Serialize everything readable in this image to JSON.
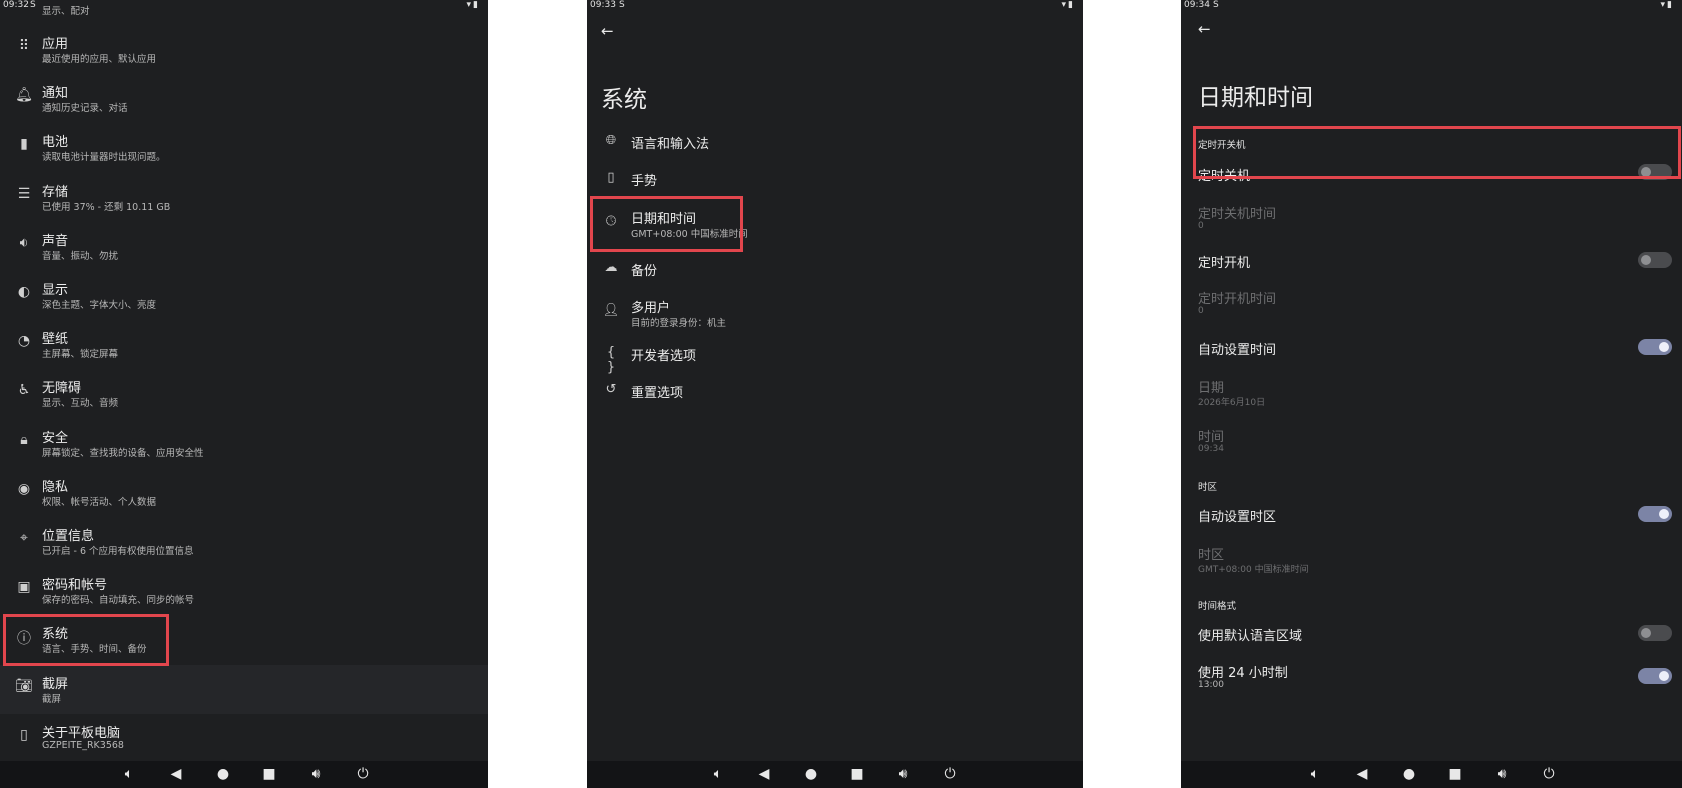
{
  "panel1": {
    "status_time": "09:32",
    "status_sim": "S",
    "status_icons": "▾▮",
    "partial_top_text": "显示、配对",
    "items": [
      {
        "icon": "apps-grid-icon",
        "glyph": "⠿",
        "title": "应用",
        "subtitle": "最近使用的应用、默认应用"
      },
      {
        "icon": "bell-icon",
        "glyph": "🔔︎",
        "title": "通知",
        "subtitle": "通知历史记录、对话"
      },
      {
        "icon": "battery-icon",
        "glyph": "▮",
        "title": "电池",
        "subtitle": "读取电池计量器时出现问题。"
      },
      {
        "icon": "storage-icon",
        "glyph": "☰",
        "title": "存储",
        "subtitle": "已使用 37% - 还剩 10.11 GB"
      },
      {
        "icon": "volume-icon",
        "glyph": "🔉︎",
        "title": "声音",
        "subtitle": "音量、振动、勿扰"
      },
      {
        "icon": "display-brightness-icon",
        "glyph": "◐",
        "title": "显示",
        "subtitle": "深色主题、字体大小、亮度"
      },
      {
        "icon": "palette-icon",
        "glyph": "◔",
        "title": "壁纸",
        "subtitle": "主屏幕、锁定屏幕"
      },
      {
        "icon": "accessibility-icon",
        "glyph": "♿︎",
        "title": "无障碍",
        "subtitle": "显示、互动、音频"
      },
      {
        "icon": "lock-icon",
        "glyph": "🔒︎",
        "title": "安全",
        "subtitle": "屏幕锁定、查找我的设备、应用安全性"
      },
      {
        "icon": "privacy-eye-icon",
        "glyph": "◉",
        "title": "隐私",
        "subtitle": "权限、帐号活动、个人数据"
      },
      {
        "icon": "location-pin-icon",
        "glyph": "⌖",
        "title": "位置信息",
        "subtitle": "已开启 - 6 个应用有权使用位置信息"
      },
      {
        "icon": "account-box-icon",
        "glyph": "▣",
        "title": "密码和帐号",
        "subtitle": "保存的密码、自动填充、同步的帐号"
      },
      {
        "icon": "info-circle-icon",
        "glyph": "ⓘ",
        "title": "系统",
        "subtitle": "语言、手势、时间、备份"
      },
      {
        "icon": "camera-icon",
        "glyph": "📷︎",
        "title": "截屏",
        "subtitle": "截屏"
      },
      {
        "icon": "tablet-icon",
        "glyph": "▯",
        "title": "关于平板电脑",
        "subtitle": "GZPEITE_RK3568"
      }
    ]
  },
  "panel2": {
    "status_time": "09:33",
    "status_sim": "S",
    "status_icons": "▾▮",
    "title": "系统",
    "items": [
      {
        "icon": "globe-icon",
        "glyph": "🌐︎",
        "title": "语言和输入法",
        "subtitle": ""
      },
      {
        "icon": "gesture-phone-icon",
        "glyph": "▯",
        "title": "手势",
        "subtitle": ""
      },
      {
        "icon": "clock-icon",
        "glyph": "🕓︎",
        "title": "日期和时间",
        "subtitle": "GMT+08:00 中国标准时间"
      },
      {
        "icon": "cloud-backup-icon",
        "glyph": "☁",
        "title": "备份",
        "subtitle": ""
      },
      {
        "icon": "person-icon",
        "glyph": "👤︎",
        "title": "多用户",
        "subtitle": "目前的登录身份：机主"
      },
      {
        "icon": "braces-icon",
        "glyph": "{ }",
        "title": "开发者选项",
        "subtitle": ""
      },
      {
        "icon": "history-reset-icon",
        "glyph": "↺",
        "title": "重置选项",
        "subtitle": ""
      }
    ]
  },
  "panel3": {
    "status_time": "09:34",
    "status_sim": "S",
    "status_icons": "▾▮",
    "title": "日期和时间",
    "sections": {
      "power_schedule": "定时开关机",
      "timezone": "时区",
      "time_format": "时间格式"
    },
    "rows": {
      "scheduled_shutdown": {
        "title": "定时关机",
        "checked": false
      },
      "shutdown_time": {
        "title": "定时关机时间",
        "subtitle": "0"
      },
      "scheduled_boot": {
        "title": "定时开机",
        "checked": false
      },
      "boot_time": {
        "title": "定时开机时间",
        "subtitle": "0"
      },
      "auto_time": {
        "title": "自动设置时间",
        "checked": true
      },
      "date": {
        "title": "日期",
        "subtitle": "2026年6月10日"
      },
      "time": {
        "title": "时间",
        "subtitle": "09:34"
      },
      "auto_timezone": {
        "title": "自动设置时区",
        "checked": true
      },
      "timezone": {
        "title": "时区",
        "subtitle": "GMT+08:00 中国标准时间"
      },
      "default_locale": {
        "title": "使用默认语言区域",
        "checked": false
      },
      "use_24h": {
        "title": "使用 24 小时制",
        "subtitle": "13:00",
        "checked": true
      }
    }
  },
  "navbar": {
    "vol_down": "🔈︎",
    "back": "◀",
    "home": "●",
    "recents": "■",
    "vol_up": "🔊︎",
    "power": "⏻"
  },
  "colors": {
    "background": "#1e1f21",
    "highlight": "#e2464d",
    "toggle_on": "#7c84a6",
    "toggle_off": "#4a4b4e"
  }
}
